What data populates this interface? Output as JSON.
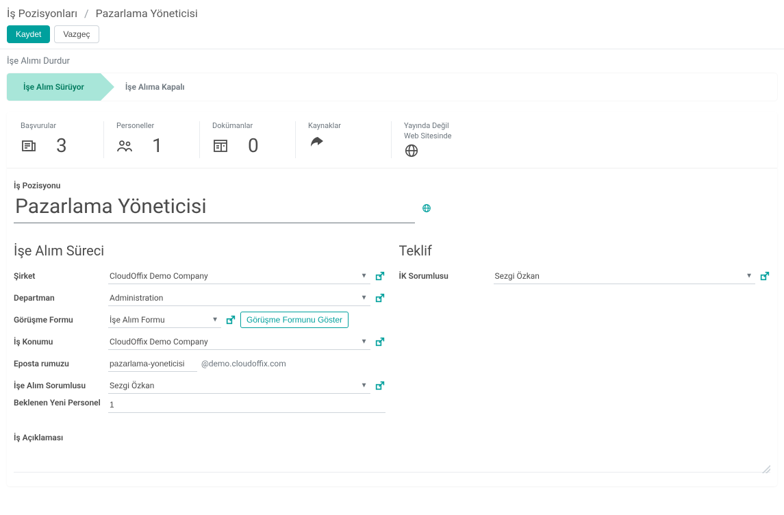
{
  "breadcrumb": {
    "parent": "İş Pozisyonları",
    "current": "Pazarlama Yöneticisi"
  },
  "actions": {
    "save": "Kaydet",
    "discard": "Vazgeç"
  },
  "subaction": "İşe Alımı Durdur",
  "status_tabs": {
    "open": "İşe Alım Sürüyor",
    "closed": "İşe Alıma Kapalı"
  },
  "stats": {
    "applications": {
      "label": "Başvurular",
      "value": "3"
    },
    "employees": {
      "label": "Personeller",
      "value": "1"
    },
    "documents": {
      "label": "Dokümanlar",
      "value": "0"
    },
    "sources": {
      "label": "Kaynaklar"
    },
    "publish": {
      "line1": "Yayında Değil",
      "line2": "Web Sitesinde"
    }
  },
  "position": {
    "label": "İş Pozisyonu",
    "value": "Pazarlama Yöneticisi"
  },
  "section_left": {
    "title": "İşe Alım Süreci",
    "company_label": "Şirket",
    "company_value": "CloudOffix Demo Company",
    "department_label": "Departman",
    "department_value": "Administration",
    "form_label": "Görüşme Formu",
    "form_value": "İşe Alım Formu",
    "form_show_btn": "Görüşme Formunu Göster",
    "location_label": "İş Konumu",
    "location_value": "CloudOffix Demo Company",
    "email_label": "Eposta rumuzu",
    "email_prefix": "pazarlama-yoneticisi",
    "email_suffix": "@demo.cloudoffix.com",
    "recruiter_label": "İşe Alım Sorumlusu",
    "recruiter_value": "Sezgi Özkan",
    "expected_label": "Beklenen Yeni Personel",
    "expected_value": "1"
  },
  "section_right": {
    "title": "Teklif",
    "hr_label": "İK Sorumlusu",
    "hr_value": "Sezgi Özkan"
  },
  "description": {
    "label": "İş Açıklaması"
  }
}
